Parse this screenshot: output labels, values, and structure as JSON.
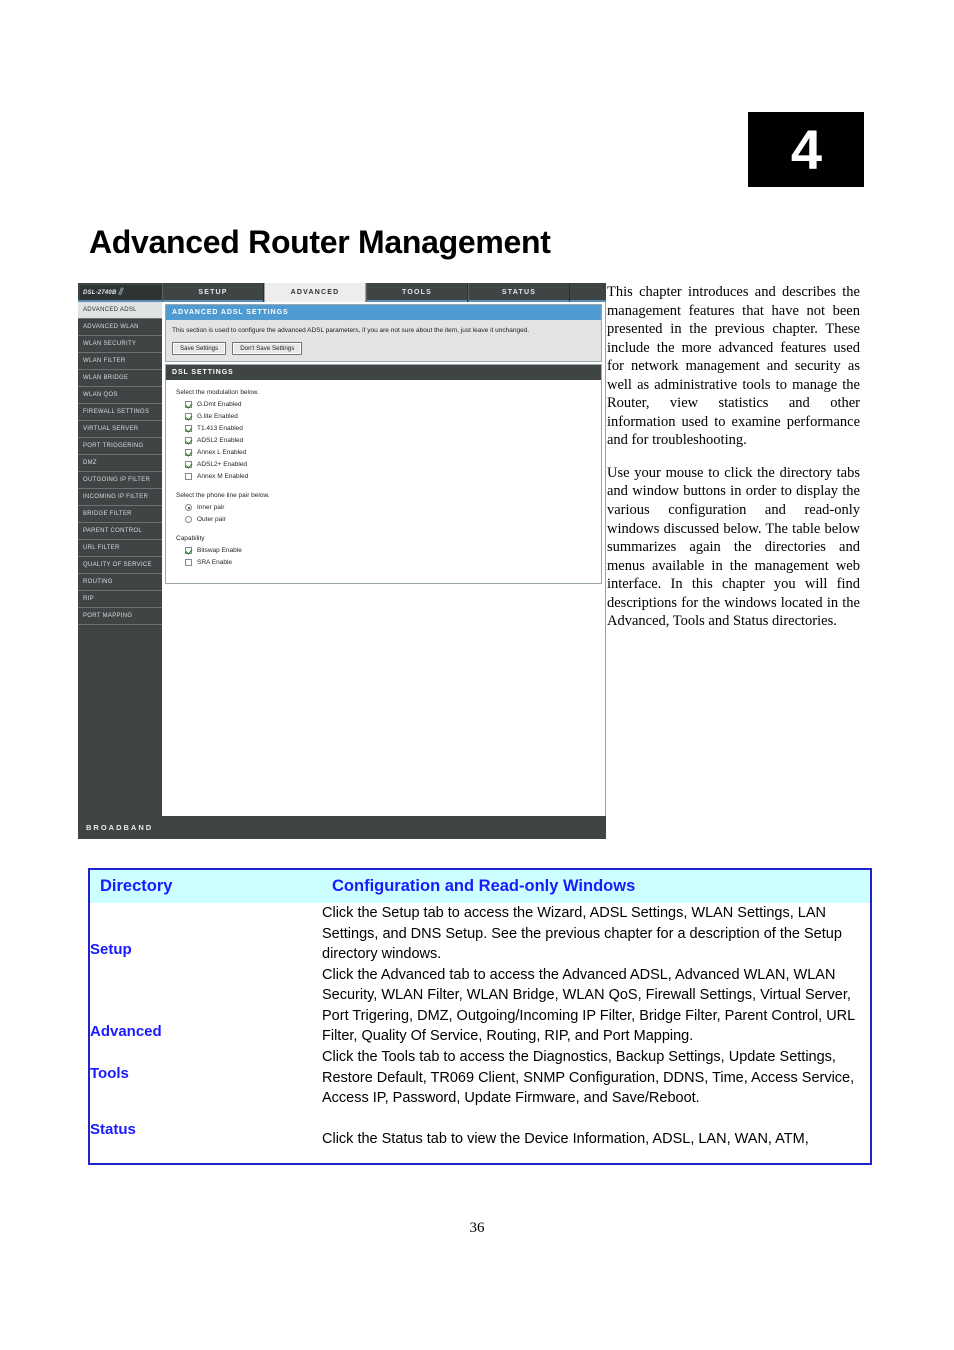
{
  "chapter": {
    "number": "4",
    "title": "Advanced Router Management"
  },
  "body": {
    "paragraph1": "This chapter introduces and describes the management features that have not been presented in the previous chapter. These include the more advanced features used for network management and security as well as administrative tools to manage the Router, view statistics and other information used to examine performance and for troubleshooting.",
    "paragraph2": "Use your mouse to click the directory tabs and window buttons in order to display the various configuration and read-only windows discussed below. The table below summarizes again the directories and menus available in the management web interface. In this chapter you will find descriptions for the windows located in the Advanced, Tools and Status directories."
  },
  "router_ui": {
    "logo_model": "DSL-2740B",
    "logo_slashes": "//",
    "tabs": [
      {
        "label": "SETUP",
        "active": false
      },
      {
        "label": "ADVANCED",
        "active": true
      },
      {
        "label": "TOOLS",
        "active": false
      },
      {
        "label": "STATUS",
        "active": false
      }
    ],
    "sidebar": [
      {
        "label": "ADVANCED ADSL",
        "active": true
      },
      {
        "label": "ADVANCED WLAN",
        "active": false
      },
      {
        "label": "WLAN SECURITY",
        "active": false
      },
      {
        "label": "WLAN FILTER",
        "active": false
      },
      {
        "label": "WLAN BRIDGE",
        "active": false
      },
      {
        "label": "WLAN QOS",
        "active": false
      },
      {
        "label": "FIREWALL SETTINGS",
        "active": false
      },
      {
        "label": "VIRTUAL SERVER",
        "active": false
      },
      {
        "label": "PORT TRIGGERING",
        "active": false
      },
      {
        "label": "DMZ",
        "active": false
      },
      {
        "label": "OUTGOING IP FILTER",
        "active": false
      },
      {
        "label": "INCOMING IP FILTER",
        "active": false
      },
      {
        "label": "BRIDGE FILTER",
        "active": false
      },
      {
        "label": "PARENT CONTROL",
        "active": false
      },
      {
        "label": "URL FILTER",
        "active": false
      },
      {
        "label": "QUALITY OF SERVICE",
        "active": false
      },
      {
        "label": "ROUTING",
        "active": false
      },
      {
        "label": "RIP",
        "active": false
      },
      {
        "label": "PORT MAPPING",
        "active": false
      }
    ],
    "panel": {
      "title": "ADVANCED ADSL SETTINGS",
      "description": "This section is used to configure the advanced ADSL parameters, if you are not sure about the item, just leave it unchanged.",
      "save_label": "Save Settings",
      "dont_save_label": "Don't Save Settings"
    },
    "dsl_settings": {
      "title": "DSL SETTINGS",
      "modulation_label": "Select the modulation below.",
      "modulation_options": [
        {
          "label": "G.Dmt Enabled",
          "checked": true
        },
        {
          "label": "G.lite Enabled",
          "checked": true
        },
        {
          "label": "T1.413 Enabled",
          "checked": true
        },
        {
          "label": "ADSL2 Enabled",
          "checked": true
        },
        {
          "label": "Annex L Enabled",
          "checked": true
        },
        {
          "label": "ADSL2+ Enabled",
          "checked": true
        },
        {
          "label": "Annex M Enabled",
          "checked": false
        }
      ],
      "pair_label": "Select the phone line pair below.",
      "pair_options": [
        {
          "label": "Inner pair",
          "selected": true
        },
        {
          "label": "Outer pair",
          "selected": false
        }
      ],
      "capability_label": "Capability",
      "capability_options": [
        {
          "label": "Bitswap Enable",
          "checked": true
        },
        {
          "label": "SRA Enable",
          "checked": false
        }
      ]
    },
    "footer": "BROADBAND"
  },
  "directory_table": {
    "header": {
      "col1": "Directory",
      "col2": "Configuration and Read-only Windows"
    },
    "rows": [
      {
        "name": "Setup",
        "description": "Click the Setup tab to access the Wizard, ADSL Settings, WLAN Settings, LAN Settings, and DNS Setup. See the previous chapter for a description of the Setup directory windows."
      },
      {
        "name": "Advanced",
        "description": "Click the Advanced tab to access the Advanced ADSL, Advanced WLAN, WLAN Security, WLAN Filter, WLAN Bridge, WLAN QoS, Firewall Settings, Virtual Server, Port Trigering, DMZ, Outgoing/Incoming IP Filter, Bridge Filter, Parent Control, URL Filter, Quality Of Service, Routing, RIP, and Port Mapping."
      },
      {
        "name": "Tools",
        "description": "Click the Tools tab to access the Diagnostics, Backup Settings, Update Settings, Restore Default, TR069 Client, SNMP Configuration, DDNS, Time, Access Service, Access IP, Password, Update Firmware, and Save/Reboot."
      },
      {
        "name": "Status",
        "description": "Click the Status tab to view the Device Information, ADSL, LAN, WAN, ATM,"
      }
    ]
  },
  "page_number": "36"
}
